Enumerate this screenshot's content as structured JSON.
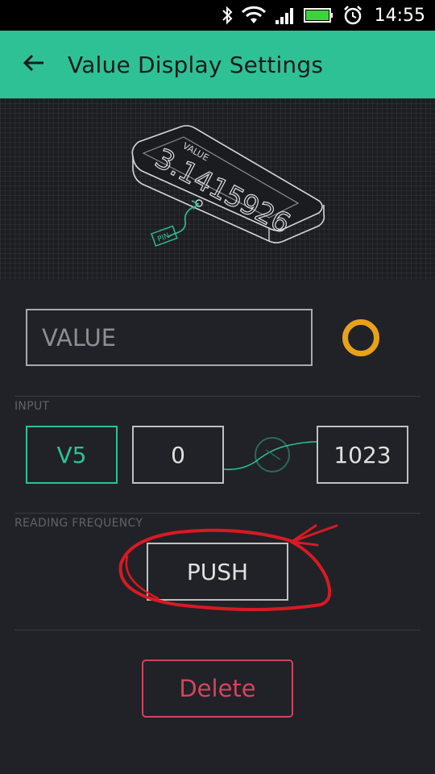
{
  "status_bar": {
    "time": "14:55",
    "icons": [
      "bluetooth-icon",
      "wifi-icon",
      "signal-icon",
      "battery-icon",
      "alarm-icon"
    ]
  },
  "app_bar": {
    "title": "Value Display Settings",
    "back_icon": "arrow-left-icon",
    "color": "#2ec196"
  },
  "hero": {
    "widget_label": "VALUE",
    "widget_value": "3.1415926",
    "pin_label": "PIN"
  },
  "widget_name": {
    "value": "VALUE",
    "color_swatch": "#e8a11a"
  },
  "input": {
    "section_label": "INPUT",
    "pin": "V5",
    "min": "0",
    "max": "1023",
    "accent": "#2ec196"
  },
  "reading_frequency": {
    "section_label": "READING FREQUENCY",
    "value": "PUSH"
  },
  "actions": {
    "delete_label": "Delete",
    "delete_color": "#d2455e"
  }
}
